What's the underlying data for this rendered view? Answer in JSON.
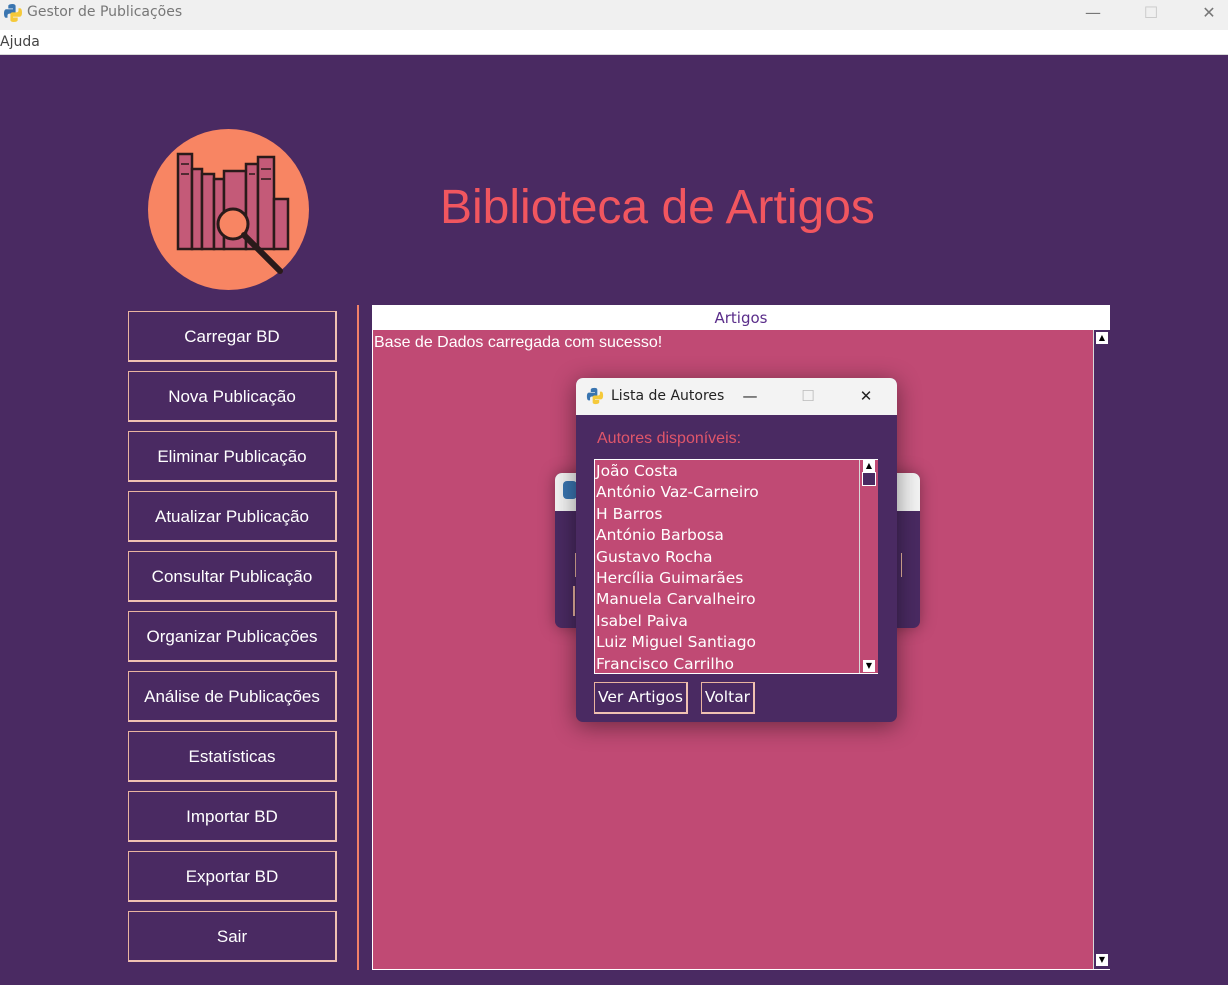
{
  "window": {
    "title": "Gestor de Publicações",
    "controls": {
      "minimize": "—",
      "maximize": "☐",
      "close": "✕"
    }
  },
  "menubar": {
    "items": [
      "Ajuda"
    ]
  },
  "header": {
    "title": "Biblioteca de Artigos",
    "logo_icon": "books-magnifier-icon"
  },
  "sidebar": {
    "buttons": [
      "Carregar BD",
      "Nova Publicação",
      "Eliminar Publicação",
      "Atualizar Publicação",
      "Consultar Publicação",
      "Organizar Publicações",
      "Análise de Publicações",
      "Estatísticas",
      "Importar BD",
      "Exportar BD",
      "Sair"
    ]
  },
  "articles_panel": {
    "header": "Artigos",
    "message": "Base de Dados carregada com sucesso!"
  },
  "authors_dialog": {
    "title": "Lista de Autores",
    "label": "Autores disponíveis:",
    "authors": [
      "João Costa",
      "António Vaz-Carneiro",
      "H Barros",
      "António Barbosa",
      "Gustavo Rocha",
      "Hercília Guimarães",
      "Manuela Carvalheiro",
      "Isabel Paiva",
      "Luiz Miguel Santiago",
      "Francisco Carrilho"
    ],
    "buttons": {
      "view": "Ver Artigos",
      "back": "Voltar"
    }
  },
  "colors": {
    "background": "#4a2a62",
    "accent": "#f1565f",
    "panel": "#c04a74",
    "logo": "#f88563"
  }
}
